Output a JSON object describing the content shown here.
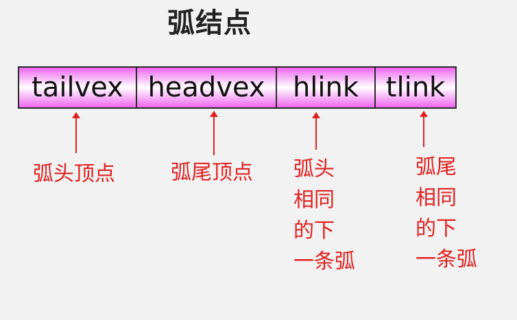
{
  "title": "弧结点",
  "fields": [
    "tailvex",
    "headvex",
    "hlink",
    "tlink"
  ],
  "annotations": {
    "tailvex": "弧头顶点",
    "headvex": "弧尾顶点",
    "hlink": [
      "弧头",
      "相同",
      "的下",
      "一条弧"
    ],
    "tlink": [
      "弧尾",
      "相同",
      "的下",
      "一条弧"
    ]
  },
  "colors": {
    "field_fill": "#ee66ee",
    "annotation": "#e02020",
    "background": "#f2f2f2"
  }
}
